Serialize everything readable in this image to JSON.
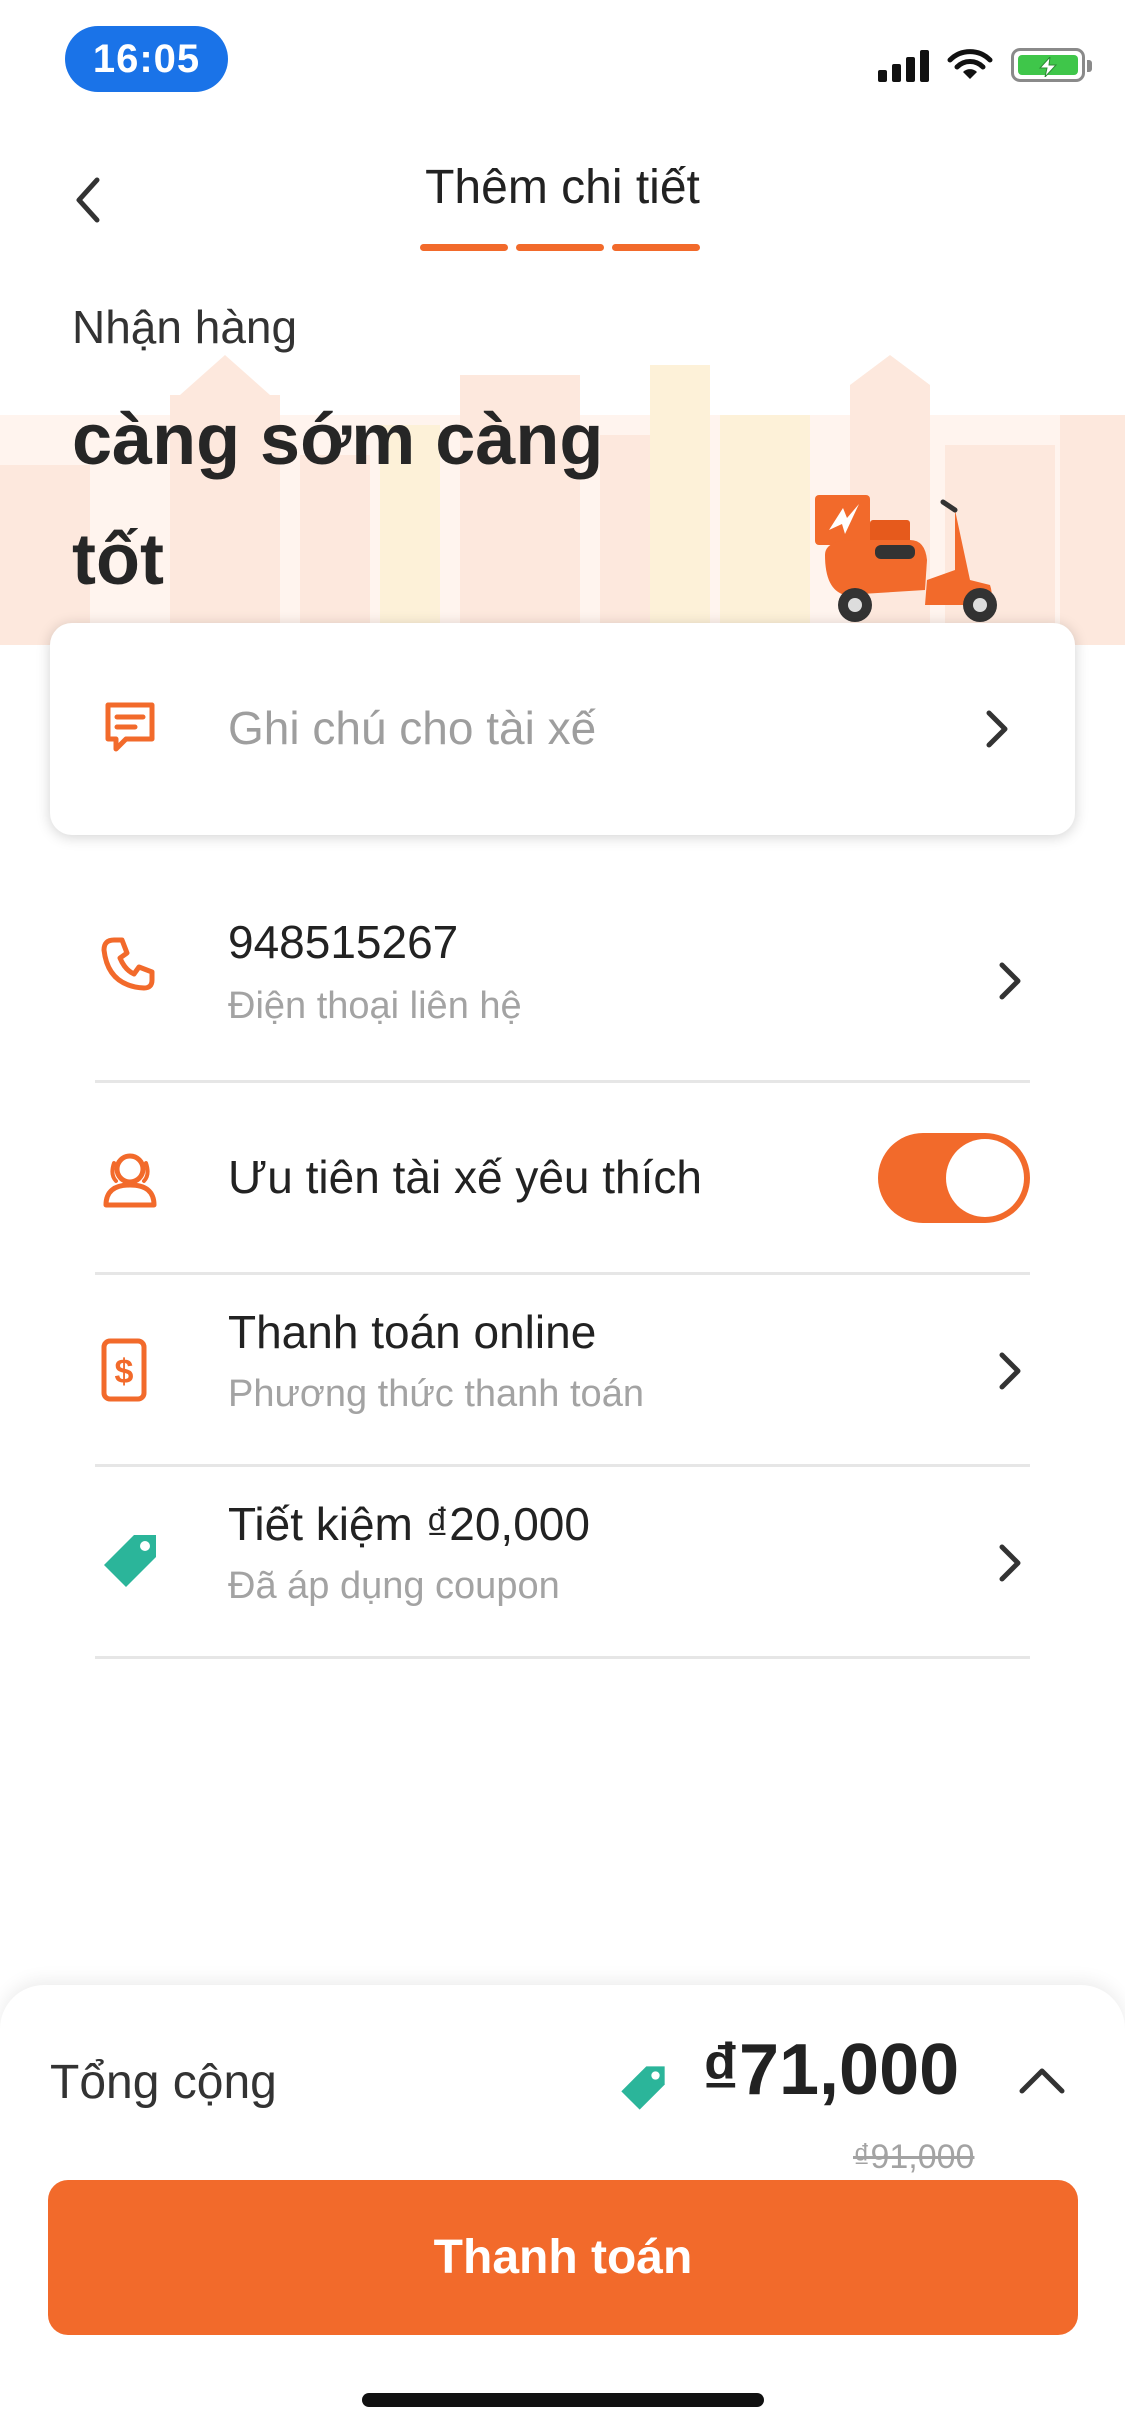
{
  "status_bar": {
    "time": "16:05"
  },
  "header": {
    "title": "Thêm chi tiết"
  },
  "hero": {
    "subtitle": "Nhận hàng",
    "title": "càng sớm càng tốt"
  },
  "note": {
    "placeholder": "Ghi chú cho tài xế"
  },
  "contact": {
    "phone": "948515267",
    "label": "Điện thoại liên hệ"
  },
  "favorite_driver": {
    "label": "Ưu tiên tài xế yêu thích",
    "enabled": true
  },
  "payment": {
    "method": "Thanh toán online",
    "label": "Phương thức thanh toán"
  },
  "coupon": {
    "title": "Tiết kiệm ₫20,000",
    "label": "Đã áp dụng coupon"
  },
  "summary": {
    "total_label": "Tổng cộng",
    "total": "₫71,000",
    "original_total": "₫91,000",
    "pay_button": "Thanh toán"
  },
  "colors": {
    "accent": "#f26a2b",
    "coupon": "#2bb59a",
    "status_pill": "#1a73e8",
    "placeholder": "#9e9e9e"
  },
  "icons": [
    "back-chevron-icon",
    "note-icon",
    "phone-icon",
    "driver-icon",
    "payment-icon",
    "coupon-tag-icon",
    "chevron-right-icon",
    "caret-up-icon"
  ]
}
